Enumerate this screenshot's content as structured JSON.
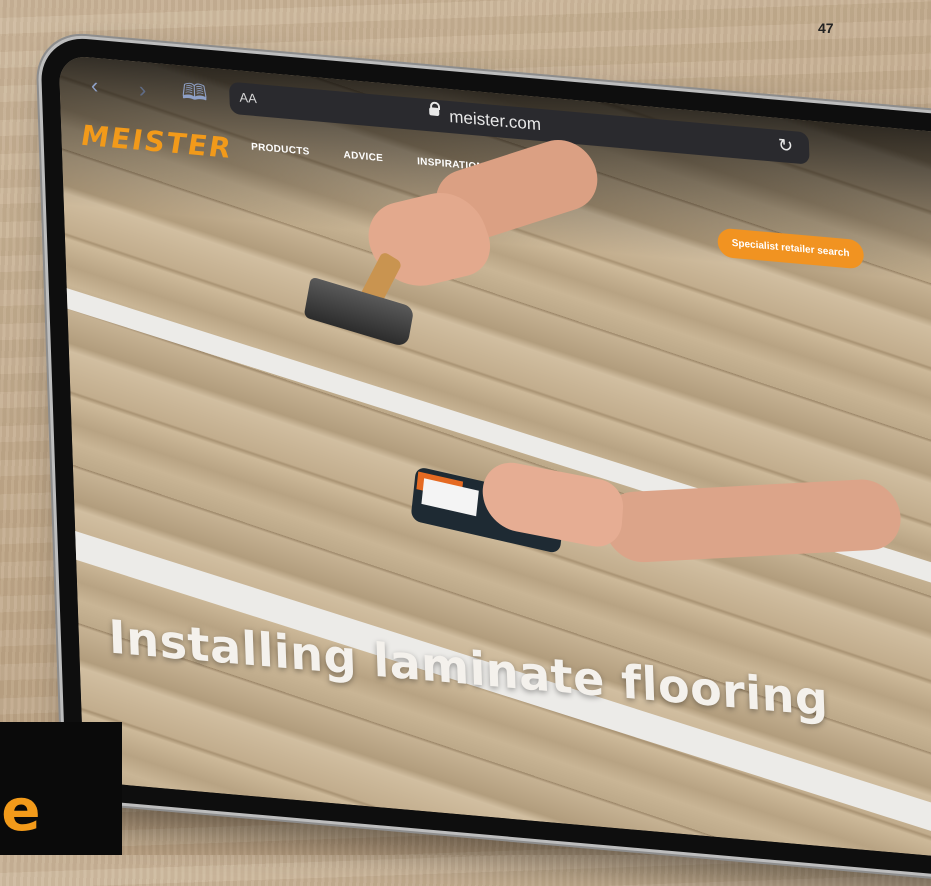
{
  "page_number": "47",
  "browser": {
    "back_icon": "‹",
    "forward_icon": "›",
    "bookmarks_icon": "🕮",
    "text_size_label": "AA",
    "url": "meister.com",
    "reload_icon": "↻"
  },
  "site": {
    "logo": "MEISTER",
    "nav": [
      "PRODUCTS",
      "ADVICE",
      "INSPIRATION"
    ],
    "cta_button": "Specialist retailer search",
    "headline": "Installing laminate flooring",
    "accent_color": "#f29a1a"
  },
  "corner": {
    "text": "ne"
  }
}
